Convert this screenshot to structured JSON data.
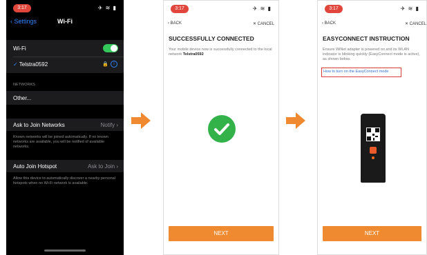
{
  "screen1": {
    "time": "3:17",
    "back_label": "Settings",
    "title": "Wi-Fi",
    "wifi_label": "Wi-Fi",
    "connected_network": "Telstra0592",
    "networks_header": "NETWORKS",
    "other_label": "Other...",
    "ask_join_label": "Ask to Join Networks",
    "ask_join_value": "Notify",
    "ask_join_desc": "Known networks will be joined automatically. If no known networks are available, you will be notified of available networks.",
    "auto_join_label": "Auto Join Hotspot",
    "auto_join_value": "Ask to Join",
    "auto_join_desc": "Allow this device to automatically discover a nearby personal hotspots when no Wi-Fi network is available."
  },
  "screen2": {
    "time": "3:17",
    "back_label": "BACK",
    "cancel_label": "CANCEL",
    "heading": "SUCCESSFULLY CONNECTED",
    "body_prefix": "Your mobile device now is successfully connected to the local network",
    "network_name": "Telstra0592",
    "next_label": "NEXT"
  },
  "screen3": {
    "time": "3:17",
    "back_label": "BACK",
    "cancel_label": "CANCEL",
    "heading": "EASYCONNECT INSTRUCTION",
    "body": "Ensure WiNet adapter is powered on and its WLAN indicator is blinking quickly (EasyConnect mode is active), as shown below.",
    "link_label": "How to turn on the EasyConnect mode",
    "next_label": "NEXT"
  },
  "colors": {
    "accent_orange": "#f08a30",
    "ios_green": "#34c759",
    "success_green": "#34b24a",
    "link_blue": "#2f6ed8",
    "highlight_red": "#d93a3a"
  },
  "icons": [
    "chevron-left-icon",
    "wifi-icon",
    "lock-icon",
    "info-icon",
    "close-icon",
    "checkmark-icon",
    "arrow-right-icon",
    "signal-icon",
    "battery-icon"
  ]
}
